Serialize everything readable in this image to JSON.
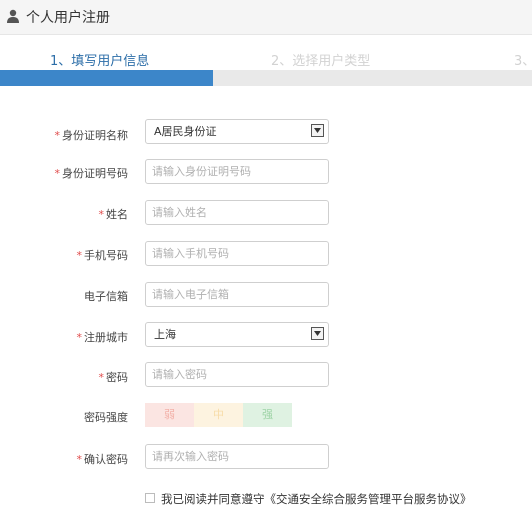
{
  "header": {
    "title": "个人用户注册",
    "icon": "user-icon"
  },
  "steps": [
    {
      "label": "1、填写用户信息",
      "state": "active"
    },
    {
      "label": "2、选择用户类型",
      "state": "inactive"
    },
    {
      "label": "3、",
      "state": "inactive"
    }
  ],
  "progress": {
    "fraction": 0.4,
    "color": "#3c86c9"
  },
  "form": {
    "id_type": {
      "label": "身份证明名称",
      "required": "*",
      "value": "A居民身份证"
    },
    "id_number": {
      "label": "身份证明号码",
      "required": "*",
      "placeholder": "请输入身份证明号码"
    },
    "name": {
      "label": "姓名",
      "required": "*",
      "placeholder": "请输入姓名"
    },
    "phone": {
      "label": "手机号码",
      "required": "*",
      "placeholder": "请输入手机号码"
    },
    "email": {
      "label": "电子信箱",
      "placeholder": "请输入电子信箱"
    },
    "city": {
      "label": "注册城市",
      "required": "*",
      "value": "上海"
    },
    "password": {
      "label": "密码",
      "required": "*",
      "placeholder": "请输入密码"
    },
    "strength": {
      "label": "密码强度",
      "weak": "弱",
      "medium": "中",
      "strong": "强"
    },
    "confirm": {
      "label": "确认密码",
      "required": "*",
      "placeholder": "请再次输入密码"
    }
  },
  "agreement": {
    "text": "我已阅读并同意遵守《交通安全综合服务管理平台服务协议》",
    "checked": false
  }
}
